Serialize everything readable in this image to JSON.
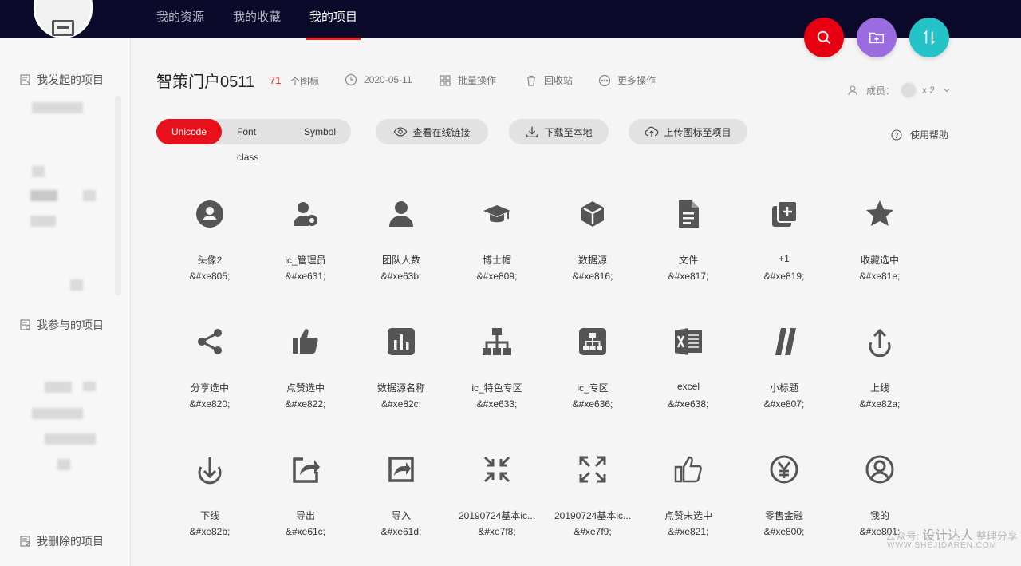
{
  "nav": [
    "我的资源",
    "我的收藏",
    "我的项目"
  ],
  "fabs": [
    {
      "name": "search-icon",
      "color": "#e60012"
    },
    {
      "name": "add-folder-icon",
      "color": "#9b6be0"
    },
    {
      "name": "sort-icon",
      "color": "#23c3c8"
    }
  ],
  "sidebar": {
    "initiated": "我发起的项目",
    "joined": "我参与的项目",
    "deleted": "我删除的项目"
  },
  "project": {
    "title": "智策门户0511",
    "icon_count": "71",
    "icon_unit": "个图标",
    "date": "2020-05-11",
    "batch": "批量操作",
    "recycle": "回收站",
    "more": "更多操作",
    "members_label": "成员：",
    "members_count": "x 2"
  },
  "tabs": [
    "Unicode",
    "Font class",
    "Symbol"
  ],
  "actions": {
    "view_link": "查看在线链接",
    "download": "下载至本地",
    "upload": "上传图标至项目",
    "help": "使用帮助"
  },
  "icons": [
    {
      "name": "头像2",
      "code": "&#xe805;",
      "icon": "avatar-icon"
    },
    {
      "name": "ic_管理员",
      "code": "&#xe631;",
      "icon": "admin-icon"
    },
    {
      "name": "团队人数",
      "code": "&#xe63b;",
      "icon": "user-icon"
    },
    {
      "name": "博士帽",
      "code": "&#xe809;",
      "icon": "graduation-cap-icon"
    },
    {
      "name": "数据源",
      "code": "&#xe816;",
      "icon": "cube-icon"
    },
    {
      "name": "文件",
      "code": "&#xe817;",
      "icon": "file-icon"
    },
    {
      "name": "+1",
      "code": "&#xe819;",
      "icon": "plus-copy-icon"
    },
    {
      "name": "收藏选中",
      "code": "&#xe81e;",
      "icon": "star-icon"
    },
    {
      "name": "分享选中",
      "code": "&#xe820;",
      "icon": "share-icon"
    },
    {
      "name": "点赞选中",
      "code": "&#xe822;",
      "icon": "thumb-up-filled-icon"
    },
    {
      "name": "数据源名称",
      "code": "&#xe82c;",
      "icon": "bar-chart-icon"
    },
    {
      "name": "ic_特色专区",
      "code": "&#xe633;",
      "icon": "org-chart-icon"
    },
    {
      "name": "ic_专区",
      "code": "&#xe636;",
      "icon": "org-chart-box-icon"
    },
    {
      "name": "excel",
      "code": "&#xe638;",
      "icon": "excel-icon"
    },
    {
      "name": "小标题",
      "code": "&#xe807;",
      "icon": "slash-icon"
    },
    {
      "name": "上线",
      "code": "&#xe82a;",
      "icon": "upload-icon"
    },
    {
      "name": "下线",
      "code": "&#xe82b;",
      "icon": "download-circle-icon"
    },
    {
      "name": "导出",
      "code": "&#xe61c;",
      "icon": "export-icon"
    },
    {
      "name": "导入",
      "code": "&#xe61d;",
      "icon": "import-icon"
    },
    {
      "name": "20190724基本ic...",
      "code": "&#xe7f8;",
      "icon": "shrink-icon"
    },
    {
      "name": "20190724基本ic...",
      "code": "&#xe7f9;",
      "icon": "expand-icon"
    },
    {
      "name": "点赞未选中",
      "code": "&#xe821;",
      "icon": "thumb-up-outline-icon"
    },
    {
      "name": "零售金融",
      "code": "&#xe800;",
      "icon": "yen-icon"
    },
    {
      "name": "我的",
      "code": "&#xe801;",
      "icon": "user-circle-icon"
    }
  ],
  "watermark": {
    "line1_prefix": "公众号:",
    "line1_brand": "设计达人",
    "line1_suffix": "整理分享",
    "line2": "WWW.SHEJIDAREN.COM"
  }
}
